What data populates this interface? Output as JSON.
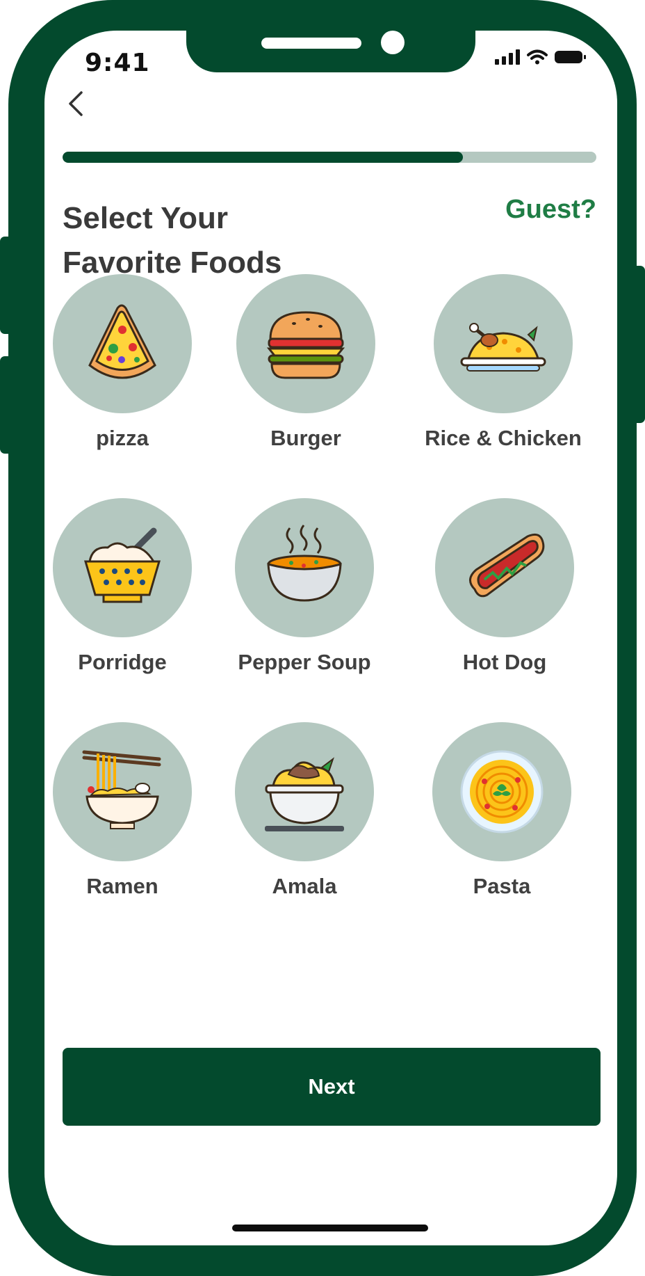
{
  "status_bar": {
    "time": "9:41"
  },
  "progress": {
    "fraction": 0.75
  },
  "header": {
    "title_line1": "Select Your",
    "title_line2": "Favorite Foods",
    "guest_link": "Guest?"
  },
  "foods": [
    {
      "label": "pizza",
      "icon": "pizza-icon"
    },
    {
      "label": "Burger",
      "icon": "burger-icon"
    },
    {
      "label": "Rice & Chicken",
      "icon": "rice-chicken-icon"
    },
    {
      "label": "Porridge",
      "icon": "porridge-icon"
    },
    {
      "label": "Pepper Soup",
      "icon": "pepper-soup-icon"
    },
    {
      "label": "Hot Dog",
      "icon": "hot-dog-icon"
    },
    {
      "label": "Ramen",
      "icon": "ramen-icon"
    },
    {
      "label": "Amala",
      "icon": "amala-icon"
    },
    {
      "label": "Pasta",
      "icon": "pasta-icon"
    }
  ],
  "footer": {
    "next_label": "Next"
  },
  "colors": {
    "brand": "#034a2d",
    "accent": "#1f7d45",
    "circle": "#b4c8c0",
    "text": "#3a3a3a"
  }
}
